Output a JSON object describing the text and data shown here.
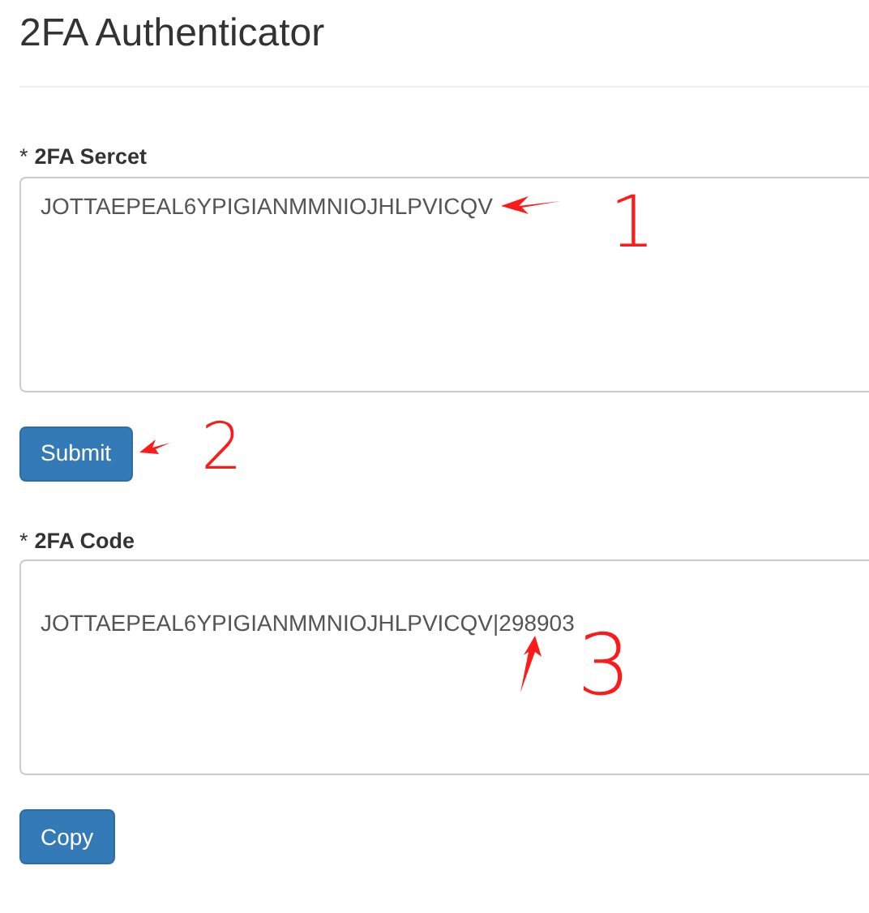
{
  "page": {
    "title": "2FA Authenticator"
  },
  "fields": [
    {
      "label": "2FA Sercet",
      "required_mark": "*",
      "value": "JOTTAEPEAL6YPIGIANMMNIOJHLPVICQV",
      "button": "Submit"
    },
    {
      "label": "2FA Code",
      "required_mark": "*",
      "value": "JOTTAEPEAL6YPIGIANMMNIOJHLPVICQV|298903",
      "button": "Copy"
    }
  ],
  "annotations": [
    {
      "label": "1"
    },
    {
      "label": "2"
    },
    {
      "label": "3"
    }
  ]
}
